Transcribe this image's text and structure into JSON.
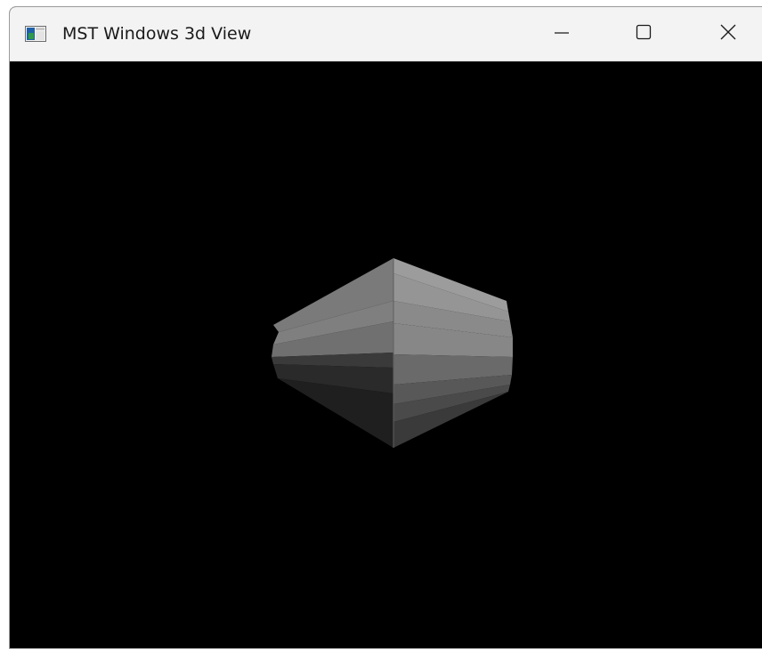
{
  "window": {
    "title": "MST Windows 3d View",
    "controls": {
      "minimize_icon": "minimize-icon",
      "maximize_icon": "maximize-icon",
      "close_icon": "close-icon"
    }
  },
  "viewport": {
    "background": "#000000",
    "object": "shaded-bicone-mesh",
    "shade_colors": {
      "light": "#9a9a9a",
      "mid": "#7a7a7a",
      "dark": "#3a3a3a",
      "darkest": "#1e1e1e"
    }
  }
}
